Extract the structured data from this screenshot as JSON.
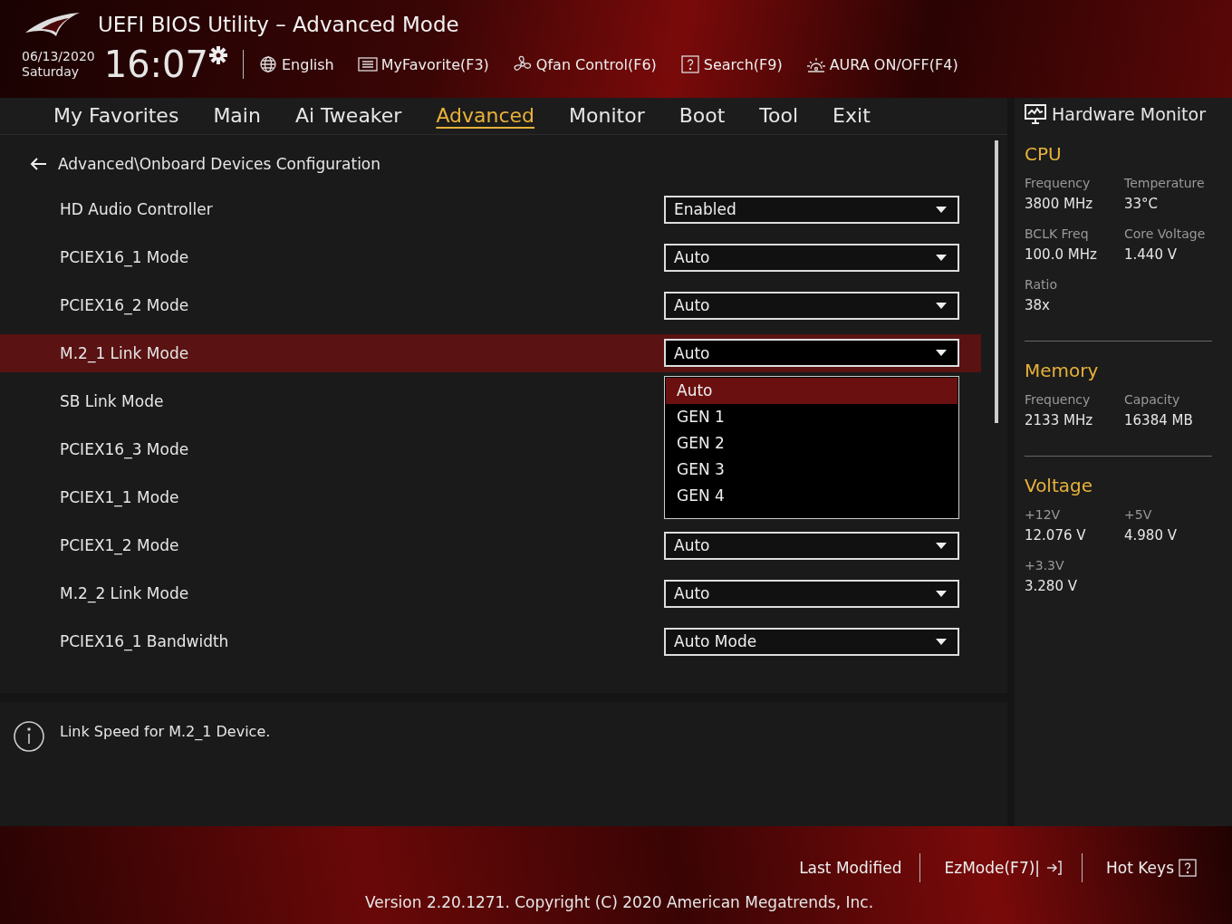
{
  "header": {
    "title": "UEFI BIOS Utility – Advanced Mode",
    "date": "06/13/2020",
    "day": "Saturday",
    "time": "16:07",
    "tools": [
      {
        "kind": "globe",
        "label": "English"
      },
      {
        "kind": "list",
        "label": "MyFavorite(F3)"
      },
      {
        "kind": "fan",
        "label": "Qfan Control(F6)"
      },
      {
        "kind": "question",
        "label": "Search(F9)"
      },
      {
        "kind": "light",
        "label": "AURA ON/OFF(F4)"
      }
    ]
  },
  "tabs": [
    {
      "label": "My Favorites",
      "selected": false
    },
    {
      "label": "Main",
      "selected": false
    },
    {
      "label": "Ai Tweaker",
      "selected": false
    },
    {
      "label": "Advanced",
      "selected": true
    },
    {
      "label": "Monitor",
      "selected": false
    },
    {
      "label": "Boot",
      "selected": false
    },
    {
      "label": "Tool",
      "selected": false
    },
    {
      "label": "Exit",
      "selected": false
    }
  ],
  "breadcrumb": "Advanced\\Onboard Devices Configuration",
  "settings": [
    {
      "label": "HD Audio Controller",
      "value": "Enabled",
      "selected": false
    },
    {
      "label": "PCIEX16_1 Mode",
      "value": "Auto",
      "selected": false
    },
    {
      "label": "PCIEX16_2 Mode",
      "value": "Auto",
      "selected": false
    },
    {
      "label": "M.2_1 Link Mode",
      "value": "Auto",
      "selected": true,
      "options": [
        {
          "label": "Auto",
          "selected": true
        },
        {
          "label": "GEN 1",
          "selected": false
        },
        {
          "label": "GEN 2",
          "selected": false
        },
        {
          "label": "GEN 3",
          "selected": false
        },
        {
          "label": "GEN 4",
          "selected": false
        }
      ]
    },
    {
      "label": "SB Link Mode",
      "selected": false
    },
    {
      "label": "PCIEX16_3 Mode",
      "selected": false
    },
    {
      "label": "PCIEX1_1 Mode",
      "selected": false
    },
    {
      "label": "PCIEX1_2 Mode",
      "value": "Auto",
      "selected": false
    },
    {
      "label": "M.2_2 Link Mode",
      "value": "Auto",
      "selected": false
    },
    {
      "label": "PCIEX16_1 Bandwidth",
      "value": "Auto Mode",
      "selected": false
    }
  ],
  "help": "Link Speed for M.2_1 Device.",
  "monitor": {
    "title": "Hardware Monitor",
    "sections": [
      {
        "title": "CPU",
        "items": [
          {
            "label": "Frequency",
            "value": "3800 MHz"
          },
          {
            "label": "Temperature",
            "value": "33°C"
          },
          {
            "label": "BCLK Freq",
            "value": "100.0 MHz"
          },
          {
            "label": "Core Voltage",
            "value": "1.440 V"
          },
          {
            "label": "Ratio",
            "value": "38x"
          }
        ]
      },
      {
        "title": "Memory",
        "items": [
          {
            "label": "Frequency",
            "value": "2133 MHz"
          },
          {
            "label": "Capacity",
            "value": "16384 MB"
          }
        ]
      },
      {
        "title": "Voltage",
        "items": [
          {
            "label": "+12V",
            "value": "12.076 V"
          },
          {
            "label": "+5V",
            "value": "4.980 V"
          },
          {
            "label": "+3.3V",
            "value": "3.280 V"
          }
        ]
      }
    ]
  },
  "footer": {
    "buttons": [
      {
        "label": "Last Modified",
        "kind": "plain"
      },
      {
        "label": "EzMode(F7)|",
        "kind": "exit"
      },
      {
        "label": "Hot Keys",
        "kind": "question"
      }
    ],
    "version": "Version 2.20.1271. Copyright (C) 2020 American Megatrends, Inc."
  }
}
